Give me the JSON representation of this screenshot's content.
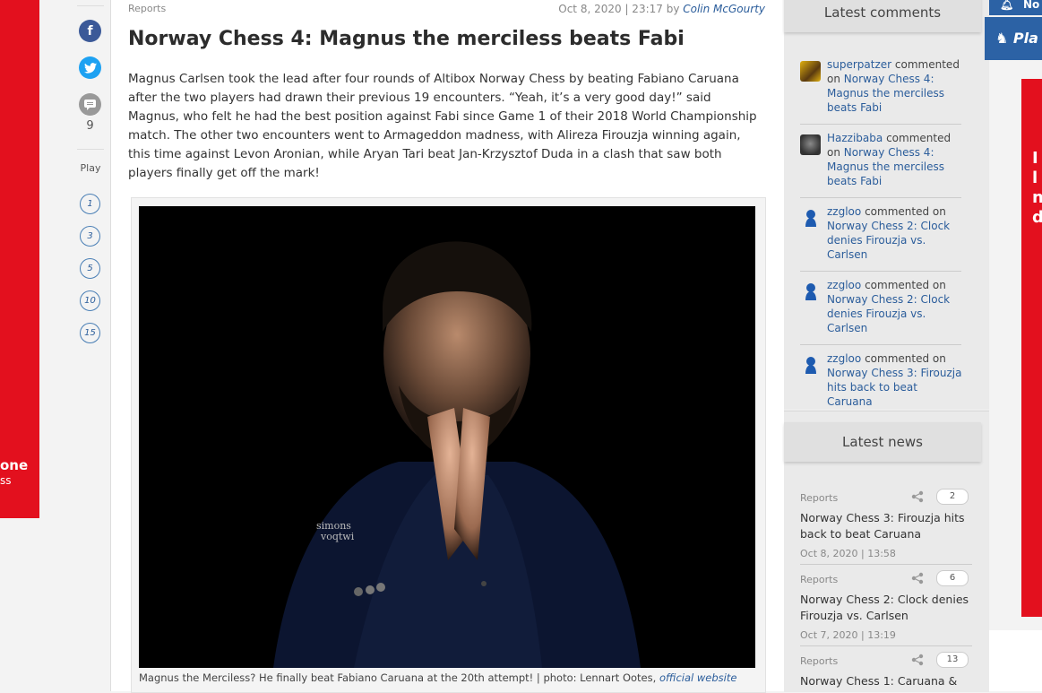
{
  "left_ad": {
    "line1": "one",
    "line2": "ss"
  },
  "share": {
    "comment_count": "9",
    "play_label": "Play",
    "play_items": [
      "1",
      "3",
      "5",
      "10",
      "15"
    ]
  },
  "article": {
    "category": "Reports",
    "date": "Oct 8, 2020 | 23:17 by",
    "author": "Colin McGourty",
    "title": "Norway Chess 4: Magnus the merciless beats Fabi",
    "lead": "Magnus Carlsen took the lead after four rounds of Altibox Norway Chess by beating Fabiano Caruana after the two players had drawn their previous 19 encounters. “Yeah, it’s a very good day!” said Magnus, who felt he had the best position against Fabi since Game 1 of their 2018 World Championship match. The other two encounters went to Armageddon madness, with Alireza Firouzja winning again, this time against Levon Aronian, while Aryan Tari beat Jan-Krzysztof Duda in a clash that saw both players finally get off the mark!",
    "caption": "Magnus the Merciless? He finally beat Fabiano Caruana at the 20th attempt! | photo: Lennart Ootes,",
    "caption_link": "official website",
    "jacket_text_1": "simons",
    "jacket_text_2": "voqtwi"
  },
  "latest_comments": {
    "title": "Latest comments",
    "items": [
      {
        "user": "superpatzer",
        "verb": "commented on",
        "link": "Norway Chess 4: Magnus the merciless beats Fabi"
      },
      {
        "user": "Hazzibaba",
        "verb": "commented on",
        "link": "Norway Chess 4: Magnus the merciless beats Fabi"
      },
      {
        "user": "zzgloo",
        "verb": "commented on",
        "link": "Norway Chess 2: Clock denies Firouzja vs. Carlsen"
      },
      {
        "user": "zzgloo",
        "verb": "commented on",
        "link": "Norway Chess 2: Clock denies Firouzja vs. Carlsen"
      },
      {
        "user": "zzgloo",
        "verb": "commented on",
        "link": "Norway Chess 3: Firouzja hits back to beat Caruana"
      }
    ]
  },
  "latest_news": {
    "title": "Latest news",
    "items": [
      {
        "category": "Reports",
        "count": "2",
        "title": "Norway Chess 3: Firouzja hits back to beat Caruana",
        "date": "Oct 8, 2020 | 13:58"
      },
      {
        "category": "Reports",
        "count": "6",
        "title": "Norway Chess 2: Clock denies Firouzja vs. Carlsen",
        "date": "Oct 7, 2020 | 13:19"
      },
      {
        "category": "Reports",
        "count": "13",
        "title": "Norway Chess 1: Caruana &",
        "date": ""
      }
    ]
  },
  "right_strip": {
    "top_text": "No",
    "play_text": "Pla",
    "ad_text": "Il n d"
  },
  "colors": {
    "accent_red": "#e3101e",
    "link_blue": "#2b5d9b",
    "nav_blue": "#2c62a5"
  }
}
